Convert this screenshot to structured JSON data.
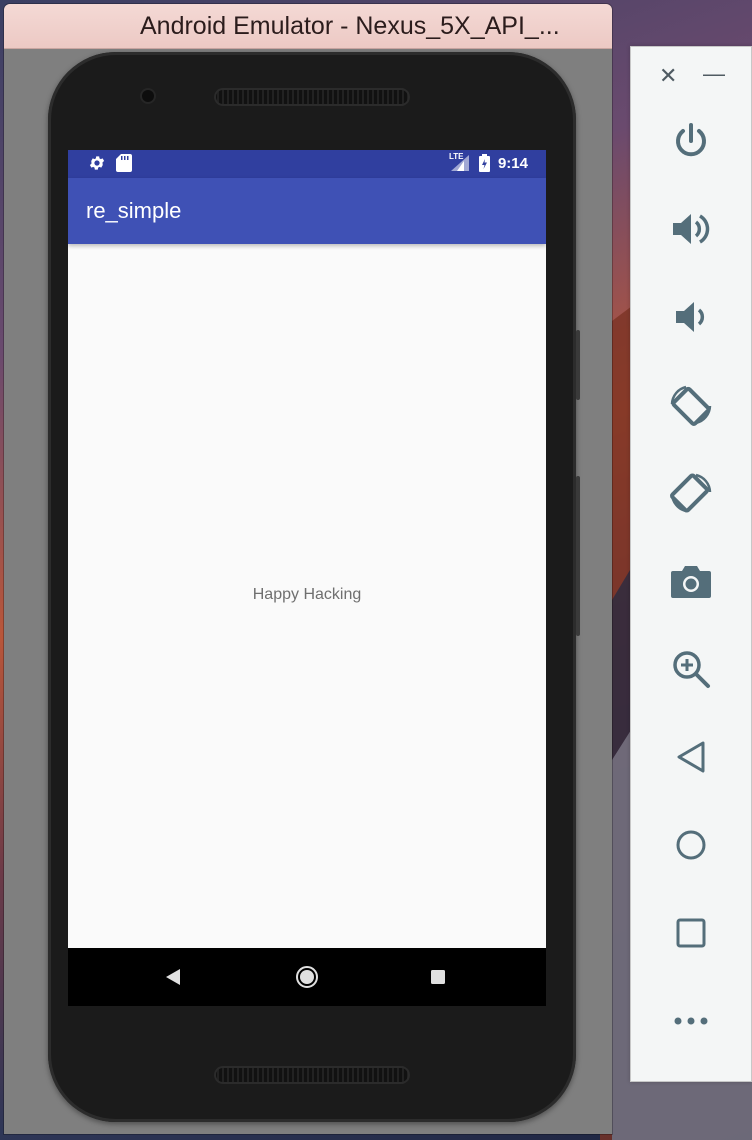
{
  "window": {
    "title": "Android Emulator - Nexus_5X_API_..."
  },
  "status_bar": {
    "time": "9:14",
    "network": "LTE",
    "icons": [
      "settings-icon",
      "sd-card-icon",
      "lte-signal-icon",
      "battery-charging-icon"
    ],
    "color": "#303f9f"
  },
  "app_bar": {
    "title": "re_simple",
    "color": "#3f51b5"
  },
  "content": {
    "text": "Happy Hacking"
  },
  "nav_bar": {
    "buttons": [
      "back-icon",
      "home-icon",
      "recents-icon"
    ]
  },
  "toolbar": {
    "controls": [
      "close-icon",
      "minimize-icon"
    ],
    "buttons": [
      "power-icon",
      "volume-up-icon",
      "volume-down-icon",
      "rotate-left-icon",
      "rotate-right-icon",
      "camera-icon",
      "zoom-icon",
      "back-icon",
      "home-icon",
      "overview-icon",
      "more-icon"
    ],
    "icon_color": "#546e7a"
  }
}
